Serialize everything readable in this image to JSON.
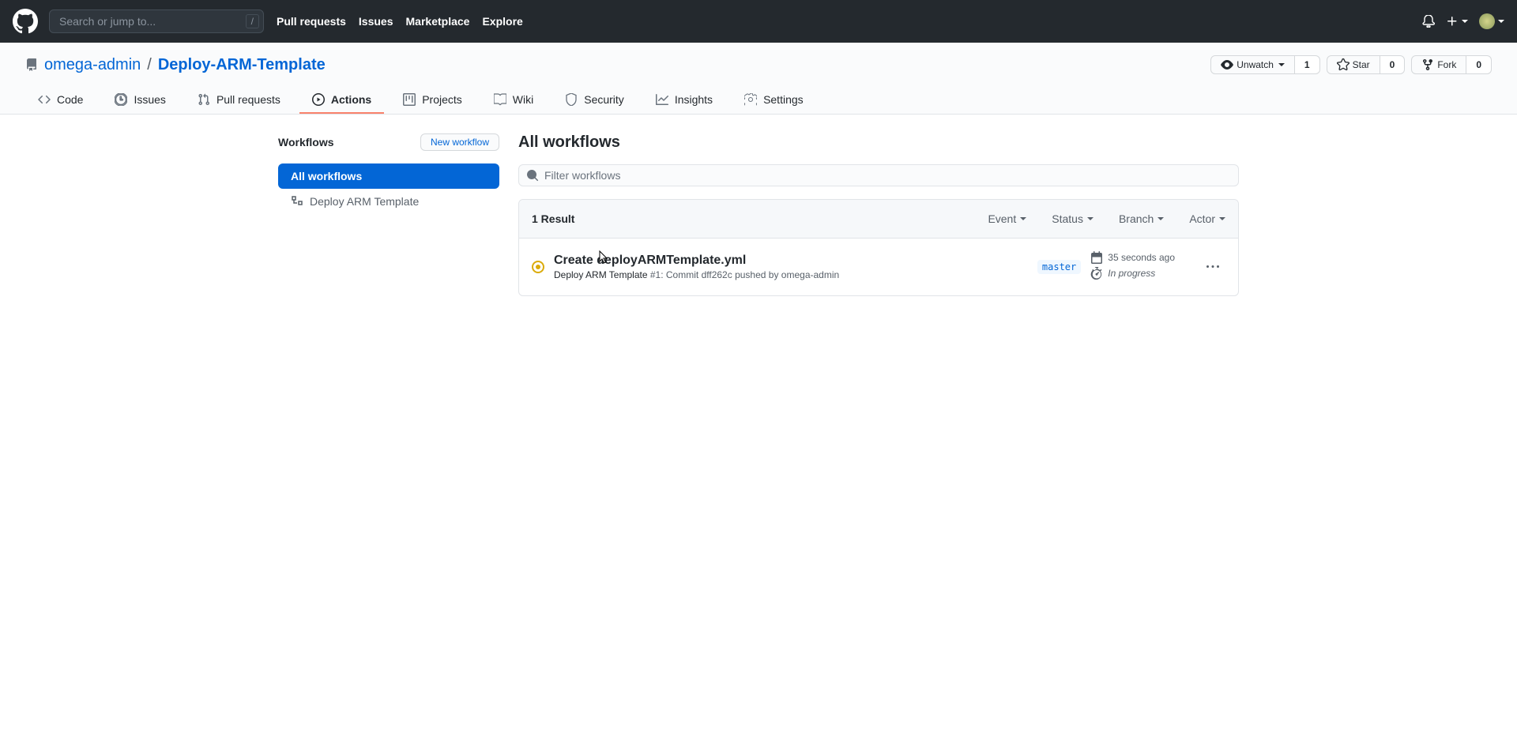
{
  "header": {
    "search_placeholder": "Search or jump to...",
    "slash": "/",
    "nav": {
      "pulls": "Pull requests",
      "issues": "Issues",
      "marketplace": "Marketplace",
      "explore": "Explore"
    }
  },
  "repo": {
    "owner": "omega-admin",
    "name": "Deploy-ARM-Template",
    "sep": "/",
    "actions": {
      "unwatch": "Unwatch",
      "unwatch_count": "1",
      "star": "Star",
      "star_count": "0",
      "fork": "Fork",
      "fork_count": "0"
    },
    "nav": {
      "code": "Code",
      "issues": "Issues",
      "pulls": "Pull requests",
      "actions": "Actions",
      "projects": "Projects",
      "wiki": "Wiki",
      "security": "Security",
      "insights": "Insights",
      "settings": "Settings"
    }
  },
  "sidebar": {
    "title": "Workflows",
    "new_button": "New workflow",
    "all": "All workflows",
    "items": [
      {
        "label": "Deploy ARM Template"
      }
    ]
  },
  "main": {
    "title": "All workflows",
    "filter_placeholder": "Filter workflows",
    "result_count": "1 Result",
    "filters": {
      "event": "Event",
      "status": "Status",
      "branch": "Branch",
      "actor": "Actor"
    },
    "runs": [
      {
        "title": "Create deployARMTemplate.yml",
        "workflow": "Deploy ARM Template",
        "number": "#1:",
        "desc_prefix": "Commit",
        "commit": "dff262c",
        "desc_mid": "pushed by",
        "actor": "omega-admin",
        "branch": "master",
        "time": "35 seconds ago",
        "status": "In progress"
      }
    ]
  }
}
